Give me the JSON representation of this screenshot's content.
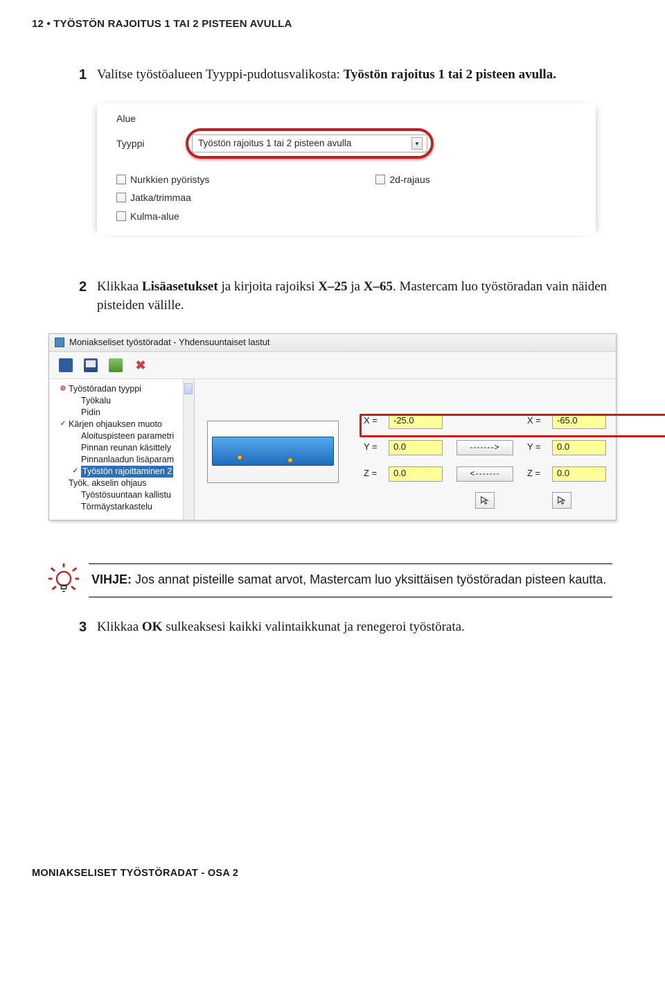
{
  "header": {
    "page": "12",
    "bullet": "•",
    "title": "TYÖSTÖN RAJOITUS 1 TAI 2 PISTEEN AVULLA"
  },
  "steps": {
    "s1": {
      "num": "1",
      "t1": "Valitse työstöalueen Tyyppi-pudotusvalikosta: ",
      "b1": "Työstön rajoitus 1 tai 2 pisteen avulla."
    },
    "s2": {
      "num": "2",
      "t1": "Klikkaa ",
      "b1": "Lisäasetukset",
      "t2": " ja kirjoita rajoiksi ",
      "b2": "X–25",
      "t3": " ja ",
      "b3": "X–65",
      "t4": ". Mastercam luo työstöradan vain näiden pisteiden välille."
    },
    "s3": {
      "num": "3",
      "t1": "Klikkaa ",
      "b1": "OK",
      "t2": " sulkeaksesi kaikki valintaikkunat ja renegeroi työstörata."
    }
  },
  "shot1": {
    "legend": "Alue",
    "label": "Tyyppi",
    "dropdown_value": "Työstön rajoitus 1 tai 2 pisteen avulla",
    "checks": {
      "c1": "Nurkkien pyöristys",
      "c2": "2d-rajaus",
      "c3": "Jatka/trimmaa",
      "c4": "Kulma-alue"
    }
  },
  "shot2": {
    "title": "Moniakseliset työstöradat - Yhdensuuntaiset lastut",
    "tree": [
      {
        "mark": "red",
        "lvl": 1,
        "label": "Työstöradan tyyppi"
      },
      {
        "mark": "none",
        "lvl": 2,
        "label": "Työkalu"
      },
      {
        "mark": "none",
        "lvl": 2,
        "label": "Pidin"
      },
      {
        "mark": "green",
        "lvl": 1,
        "label": "Kärjen ohjauksen muoto"
      },
      {
        "mark": "none",
        "lvl": 2,
        "label": "Aloituspisteen parametri"
      },
      {
        "mark": "none",
        "lvl": 2,
        "label": "Pinnan reunan käsittely"
      },
      {
        "mark": "none",
        "lvl": 2,
        "label": "Pinnanlaadun lisäparam"
      },
      {
        "mark": "green",
        "lvl": 2,
        "label": "Työstön rajoittaminen 2",
        "selected": true
      },
      {
        "mark": "none",
        "lvl": 1,
        "label": "Työk. akselin ohjaus"
      },
      {
        "mark": "none",
        "lvl": 2,
        "label": "Työstösuuntaan kallistu"
      },
      {
        "mark": "none",
        "lvl": 2,
        "label": "Törmäystarkastelu"
      }
    ],
    "coords": {
      "xl": "X =",
      "yl": "Y =",
      "zl": "Z =",
      "x1": "-25.0",
      "y1": "0.0",
      "z1": "0.0",
      "x2": "-65.0",
      "y2": "0.0",
      "z2": "0.0",
      "arr_r": "------->",
      "arr_l": "<-------"
    }
  },
  "tip": {
    "label": "VIHJE:",
    "text": " Jos annat pisteille samat arvot, Mastercam luo yksittäisen työstöradan pisteen kautta."
  },
  "footer": "MONIAKSELISET TYÖSTÖRADAT - OSA 2"
}
